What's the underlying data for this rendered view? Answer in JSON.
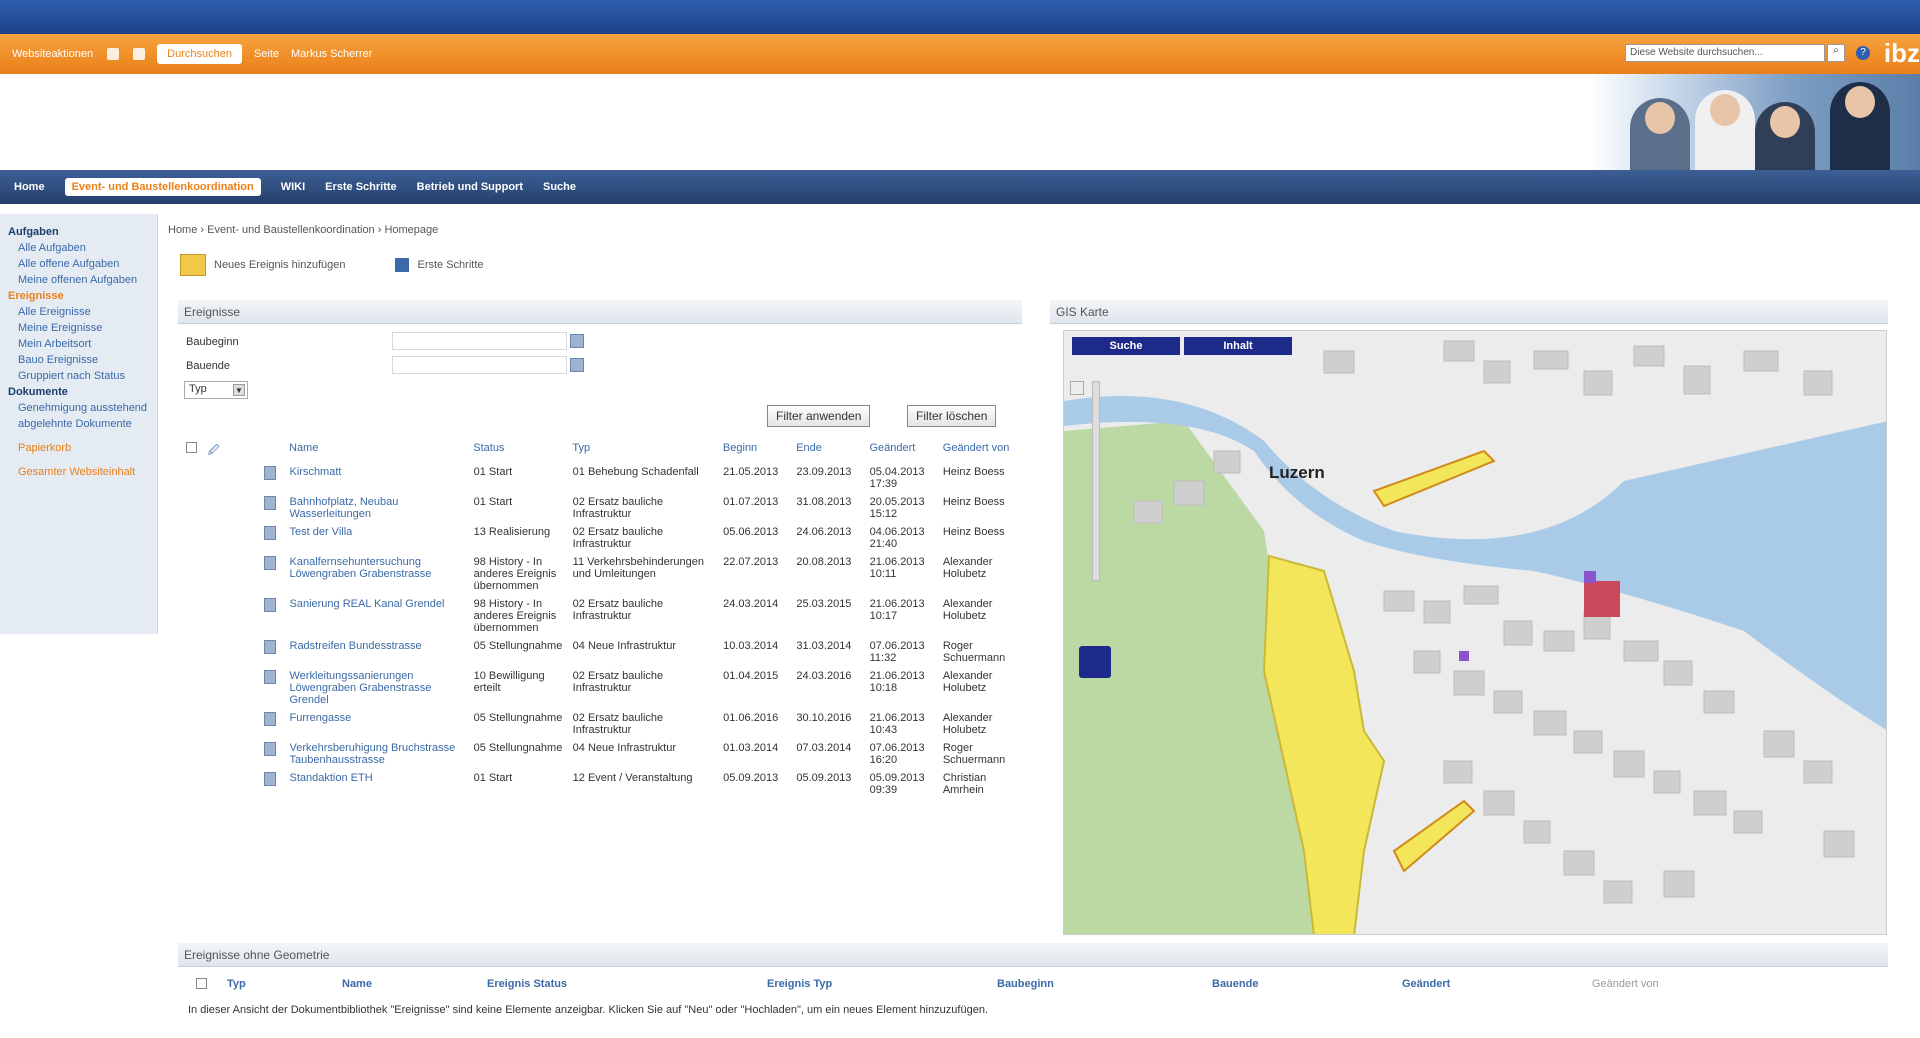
{
  "topbar": {
    "site_label": "Websiteaktionen",
    "tabs": [
      "Durchsuchen",
      "Seite",
      "Markus Scherrer"
    ],
    "search_placeholder": "Diese Website durchsuchen...",
    "logo": "ibz"
  },
  "nav": {
    "items": [
      "Home",
      "Event- und Baustellenkoordination",
      "WIKI",
      "Erste Schritte",
      "Betrieb und Support",
      "Suche"
    ]
  },
  "leftnav": {
    "sections": [
      {
        "title": "Aufgaben",
        "items": [
          "Alle Aufgaben",
          "Alle offene Aufgaben",
          "Meine offenen Aufgaben"
        ]
      },
      {
        "title": "Ereignisse",
        "items": [
          "Alle Ereignisse",
          "Meine Ereignisse",
          "Mein Arbeitsort",
          "Bauo Ereignisse",
          "Gruppiert nach Status"
        ]
      },
      {
        "title": "Dokumente",
        "items": [
          "Genehmigung ausstehend",
          "abgelehnte Dokumente"
        ]
      }
    ],
    "extra1": "Papierkorb",
    "extra2": "Gesamter Websiteinhalt"
  },
  "breadcrumb": "Home › Event- und Baustellenkoordination › Homepage",
  "actions": {
    "new_event": "Neues Ereignis hinzufügen",
    "first_steps": "Erste Schritte"
  },
  "events_panel": {
    "title": "Ereignisse",
    "filter_start_label": "Baubeginn",
    "filter_end_label": "Bauende",
    "type_select": "Typ",
    "apply_button": "Filter anwenden",
    "clear_button": "Filter löschen",
    "columns": [
      "Name",
      "Status",
      "Typ",
      "Beginn",
      "Ende",
      "Geändert",
      "Geändert von"
    ],
    "rows": [
      {
        "name": "Kirschmatt",
        "status": "01 Start",
        "typ": "01 Behebung Schadenfall",
        "beginn": "21.05.2013",
        "ende": "23.09.2013",
        "geaendert": "05.04.2013 17:39",
        "von": "Heinz Boess"
      },
      {
        "name": "Bahnhofplatz, Neubau Wasserleitungen",
        "status": "01 Start",
        "typ": "02 Ersatz bauliche Infrastruktur",
        "beginn": "01.07.2013",
        "ende": "31.08.2013",
        "geaendert": "20.05.2013 15:12",
        "von": "Heinz Boess"
      },
      {
        "name": "Test der Villa",
        "status": "13 Realisierung",
        "typ": "02 Ersatz bauliche Infrastruktur",
        "beginn": "05.06.2013",
        "ende": "24.06.2013",
        "geaendert": "04.06.2013 21:40",
        "von": "Heinz Boess"
      },
      {
        "name": "Kanalfernsehuntersuchung Löwengraben Grabenstrasse",
        "status": "98 History - In anderes Ereignis übernommen",
        "typ": "11 Verkehrsbehinderungen und Umleitungen",
        "beginn": "22.07.2013",
        "ende": "20.08.2013",
        "geaendert": "21.06.2013 10:11",
        "von": "Alexander Holubetz"
      },
      {
        "name": "Sanierung REAL Kanal Grendel",
        "status": "98 History - In anderes Ereignis übernommen",
        "typ": "02 Ersatz bauliche Infrastruktur",
        "beginn": "24.03.2014",
        "ende": "25.03.2015",
        "geaendert": "21.06.2013 10:17",
        "von": "Alexander Holubetz"
      },
      {
        "name": "Radstreifen Bundesstrasse",
        "status": "05 Stellungnahme",
        "typ": "04 Neue Infrastruktur",
        "beginn": "10.03.2014",
        "ende": "31.03.2014",
        "geaendert": "07.06.2013 11:32",
        "von": "Roger Schuermann"
      },
      {
        "name": "Werkleitungssanierungen Löwengraben Grabenstrasse Grendel",
        "status": "10 Bewilligung erteilt",
        "typ": "02 Ersatz bauliche Infrastruktur",
        "beginn": "01.04.2015",
        "ende": "24.03.2016",
        "geaendert": "21.06.2013 10:18",
        "von": "Alexander Holubetz"
      },
      {
        "name": "Furrengasse",
        "status": "05 Stellungnahme",
        "typ": "02 Ersatz bauliche Infrastruktur",
        "beginn": "01.06.2016",
        "ende": "30.10.2016",
        "geaendert": "21.06.2013 10:43",
        "von": "Alexander Holubetz"
      },
      {
        "name": "Verkehrsberuhigung Bruchstrasse Taubenhausstrasse",
        "status": "05 Stellungnahme",
        "typ": "04 Neue Infrastruktur",
        "beginn": "01.03.2014",
        "ende": "07.03.2014",
        "geaendert": "07.06.2013 16:20",
        "von": "Roger Schuermann"
      },
      {
        "name": "Standaktion ETH",
        "status": "01 Start",
        "typ": "12 Event / Veranstaltung",
        "beginn": "05.09.2013",
        "ende": "05.09.2013",
        "geaendert": "05.09.2013 09:39",
        "von": "Christian Amrhein"
      }
    ]
  },
  "map_panel": {
    "title": "GIS Karte",
    "search_button": "Suche",
    "content_button": "Inhalt",
    "city_label": "Luzern"
  },
  "bottom_panel": {
    "title": "Ereignisse ohne Geometrie",
    "columns": [
      "Typ",
      "Name",
      "Ereignis Status",
      "Ereignis Typ",
      "Baubeginn",
      "Bauende",
      "Geändert",
      "Geändert von"
    ],
    "empty_message": "In dieser Ansicht der Dokumentbibliothek \"Ereignisse\" sind keine Elemente anzeigbar. Klicken Sie auf \"Neu\" oder \"Hochladen\", um ein neues Element hinzuzufügen."
  }
}
